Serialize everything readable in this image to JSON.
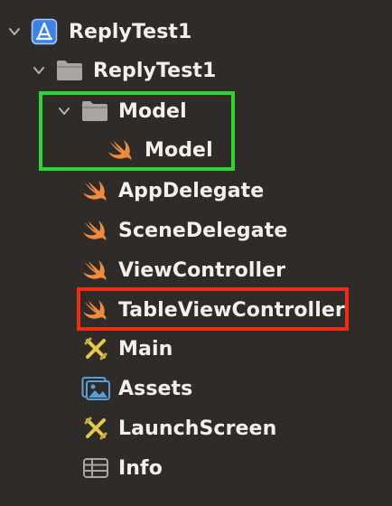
{
  "navigator": {
    "project": {
      "label": "ReplyTest1",
      "icon": "xcode-project-icon",
      "expanded": true
    },
    "group": {
      "label": "ReplyTest1",
      "icon": "folder-icon",
      "expanded": true
    },
    "model_group": {
      "label": "Model",
      "icon": "folder-icon",
      "expanded": true
    },
    "files": [
      {
        "label": "Model",
        "icon": "swift-file-icon"
      },
      {
        "label": "AppDelegate",
        "icon": "swift-file-icon"
      },
      {
        "label": "SceneDelegate",
        "icon": "swift-file-icon"
      },
      {
        "label": "ViewController",
        "icon": "swift-file-icon"
      },
      {
        "label": "TableViewController",
        "icon": "swift-file-icon"
      },
      {
        "label": "Main",
        "icon": "storyboard-icon"
      },
      {
        "label": "Assets",
        "icon": "asset-catalog-icon"
      },
      {
        "label": "LaunchScreen",
        "icon": "storyboard-icon"
      },
      {
        "label": "Info",
        "icon": "plist-icon"
      }
    ]
  },
  "annotations": {
    "green_box_color": "#2bd82b",
    "red_box_color": "#f02d14"
  },
  "colors": {
    "background": "#2f2b29",
    "text": "#f2efec",
    "swift": "#f08a3c",
    "folder": "#a8a5a3",
    "project": "#3d82e6"
  }
}
